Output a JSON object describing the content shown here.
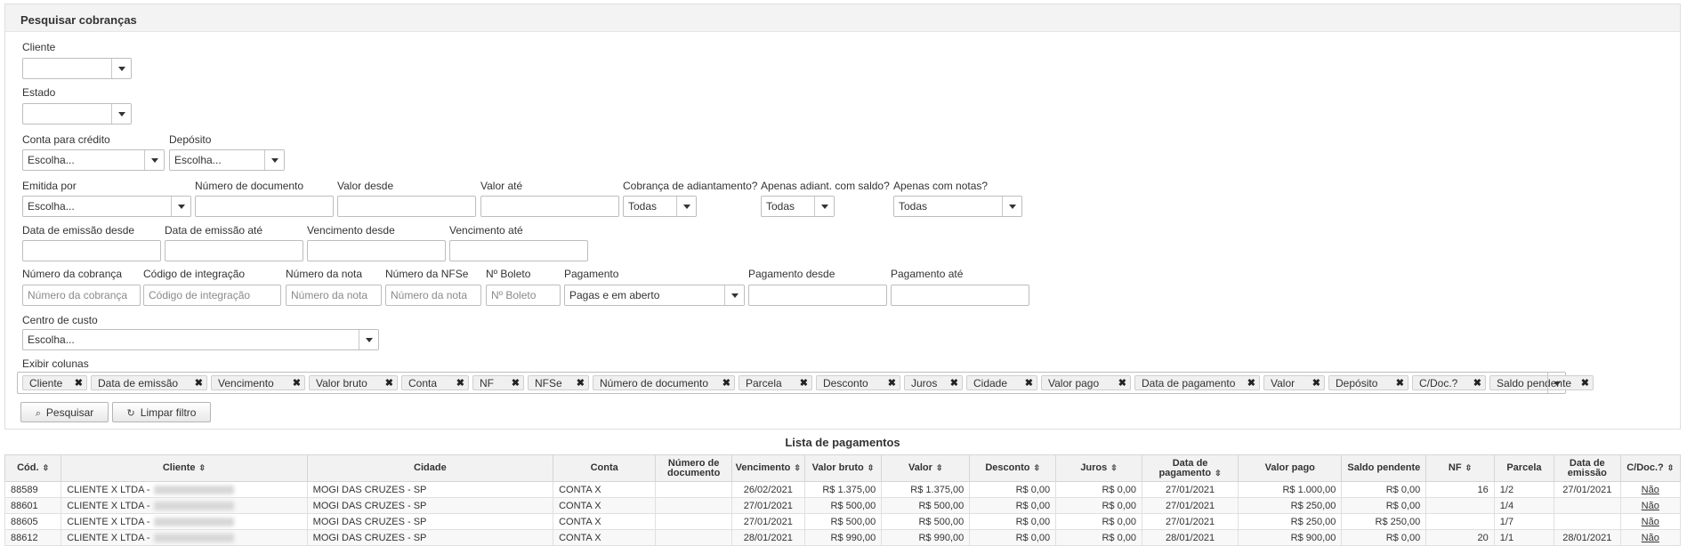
{
  "form": {
    "title": "Pesquisar cobranças",
    "cliente": {
      "label": "Cliente",
      "value": ""
    },
    "estado": {
      "label": "Estado",
      "value": ""
    },
    "conta_credito": {
      "label": "Conta para crédito",
      "value": "Escolha..."
    },
    "deposito": {
      "label": "Depósito",
      "value": "Escolha..."
    },
    "emitida_por": {
      "label": "Emitida por",
      "value": "Escolha..."
    },
    "numero_documento": {
      "label": "Número de documento",
      "value": ""
    },
    "valor_desde": {
      "label": "Valor desde",
      "value": ""
    },
    "valor_ate": {
      "label": "Valor até",
      "value": ""
    },
    "cobranca_adiantamento": {
      "label": "Cobrança de adiantamento?",
      "value": "Todas"
    },
    "apenas_adiant_saldo": {
      "label": "Apenas adiant. com saldo?",
      "value": "Todas"
    },
    "apenas_notas": {
      "label": "Apenas com notas?",
      "value": "Todas"
    },
    "data_emissao_desde": {
      "label": "Data de emissão desde",
      "value": ""
    },
    "data_emissao_ate": {
      "label": "Data de emissão até",
      "value": ""
    },
    "vencimento_desde": {
      "label": "Vencimento desde",
      "value": ""
    },
    "vencimento_ate": {
      "label": "Vencimento até",
      "value": ""
    },
    "numero_cobranca": {
      "label": "Número da cobrança",
      "placeholder": "Número da cobrança"
    },
    "codigo_integracao": {
      "label": "Código de integração",
      "placeholder": "Código de integração"
    },
    "numero_nota": {
      "label": "Número da nota",
      "placeholder": "Número da nota"
    },
    "numero_nfse": {
      "label": "Número da NFSe",
      "placeholder": "Número da nota"
    },
    "numero_boleto": {
      "label": "Nº Boleto",
      "placeholder": "Nº Boleto"
    },
    "pagamento": {
      "label": "Pagamento",
      "value": "Pagas e em aberto"
    },
    "pagamento_desde": {
      "label": "Pagamento desde",
      "value": ""
    },
    "pagamento_ate": {
      "label": "Pagamento até",
      "value": ""
    },
    "centro_custo": {
      "label": "Centro de custo",
      "value": "Escolha..."
    },
    "exibir_colunas": {
      "label": "Exibir colunas",
      "tags": [
        "Cliente",
        "Data de emissão",
        "Vencimento",
        "Valor bruto",
        "Conta",
        "NF",
        "NFSe",
        "Número de documento",
        "Parcela",
        "Desconto",
        "Juros",
        "Cidade",
        "Valor pago",
        "Data de pagamento",
        "Valor",
        "Depósito",
        "C/Doc.?",
        "Saldo pendente"
      ],
      "remove_glyph": "✖"
    },
    "pesquisar_label": "Pesquisar",
    "limpar_label": "Limpar filtro"
  },
  "list": {
    "title": "Lista de pagamentos",
    "sort_glyph": "⇳",
    "headers": [
      "Cód.",
      "Cliente",
      "Cidade",
      "Conta",
      "Número de documento",
      "Vencimento",
      "Valor bruto",
      "Valor",
      "Desconto",
      "Juros",
      "Data de pagamento",
      "Valor pago",
      "Saldo pendente",
      "NF",
      "Parcela",
      "Data de emissão",
      "C/Doc.?"
    ],
    "rows": [
      {
        "cod": "88589",
        "cliente": "CLIENTE X LTDA -",
        "cidade": "MOGI DAS CRUZES - SP",
        "conta": "CONTA X",
        "numero_documento": "",
        "vencimento": "26/02/2021",
        "valor_bruto": "R$ 1.375,00",
        "valor": "R$ 1.375,00",
        "desconto": "R$ 0,00",
        "juros": "R$ 0,00",
        "data_pagamento": "27/01/2021",
        "valor_pago": "R$ 1.000,00",
        "saldo_pendente": "R$ 0,00",
        "nf": "16",
        "parcela": "1/2",
        "data_emissao": "27/01/2021",
        "cdoc": "Não"
      },
      {
        "cod": "88601",
        "cliente": "CLIENTE X LTDA -",
        "cidade": "MOGI DAS CRUZES - SP",
        "conta": "CONTA X",
        "numero_documento": "",
        "vencimento": "27/01/2021",
        "valor_bruto": "R$ 500,00",
        "valor": "R$ 500,00",
        "desconto": "R$ 0,00",
        "juros": "R$ 0,00",
        "data_pagamento": "27/01/2021",
        "valor_pago": "R$ 250,00",
        "saldo_pendente": "R$ 0,00",
        "nf": "",
        "parcela": "1/4",
        "data_emissao": "",
        "cdoc": "Não"
      },
      {
        "cod": "88605",
        "cliente": "CLIENTE X LTDA -",
        "cidade": "MOGI DAS CRUZES - SP",
        "conta": "CONTA X",
        "numero_documento": "",
        "vencimento": "27/01/2021",
        "valor_bruto": "R$ 500,00",
        "valor": "R$ 500,00",
        "desconto": "R$ 0,00",
        "juros": "R$ 0,00",
        "data_pagamento": "27/01/2021",
        "valor_pago": "R$ 250,00",
        "saldo_pendente": "R$ 250,00",
        "nf": "",
        "parcela": "1/7",
        "data_emissao": "",
        "cdoc": "Não"
      },
      {
        "cod": "88612",
        "cliente": "CLIENTE X LTDA -",
        "cidade": "MOGI DAS CRUZES - SP",
        "conta": "CONTA X",
        "numero_documento": "",
        "vencimento": "28/01/2021",
        "valor_bruto": "R$ 990,00",
        "valor": "R$ 990,00",
        "desconto": "R$ 0,00",
        "juros": "R$ 0,00",
        "data_pagamento": "28/01/2021",
        "valor_pago": "R$ 900,00",
        "saldo_pendente": "R$ 0,00",
        "nf": "20",
        "parcela": "1/1",
        "data_emissao": "28/01/2021",
        "cdoc": "Não"
      }
    ]
  },
  "colors": {
    "negative_value": "#e00000",
    "paid_value": "#0000e0"
  }
}
